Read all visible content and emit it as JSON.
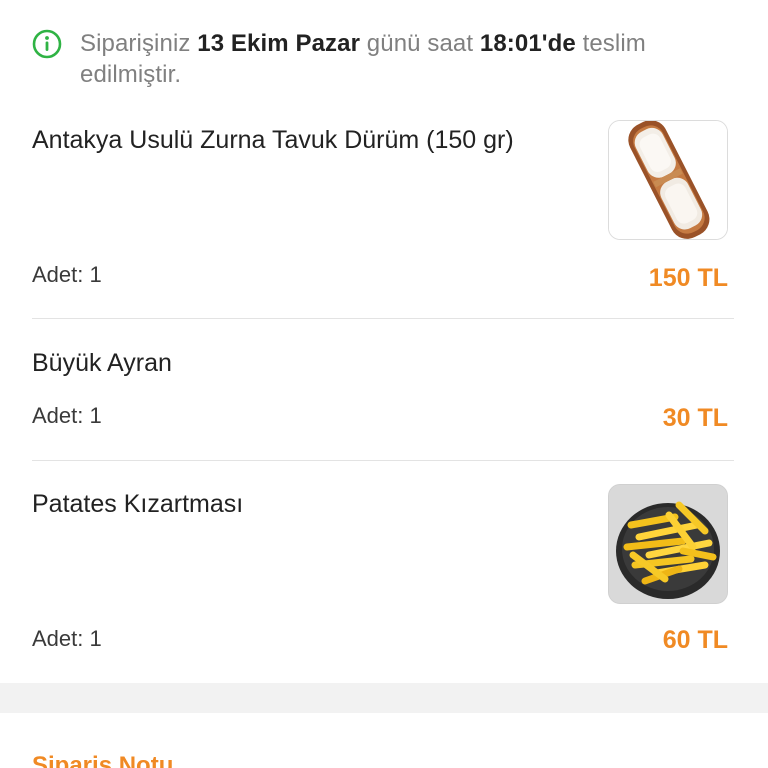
{
  "status": {
    "prefix": "Siparişiniz",
    "date": "13 Ekim Pazar",
    "middle": "günü saat",
    "time": "18:01'de",
    "suffix": "teslim edilmiştir."
  },
  "items": [
    {
      "name": "Antakya Usulü Zurna Tavuk Dürüm (150 gr)",
      "qty": "Adet: 1",
      "price": "150 TL",
      "image": "wrap-on-wooden-board"
    },
    {
      "name": "Büyük Ayran",
      "qty": "Adet: 1",
      "price": "30 TL"
    },
    {
      "name": "Patates Kızartması",
      "qty": "Adet: 1",
      "price": "60 TL",
      "image": "french-fries-bowl"
    }
  ],
  "note": {
    "title": "Sipariş Notu"
  },
  "colors": {
    "accent": "#f08a24",
    "success": "#2fb344",
    "divider": "#e3e3e3",
    "section_bg": "#f2f2f2"
  }
}
